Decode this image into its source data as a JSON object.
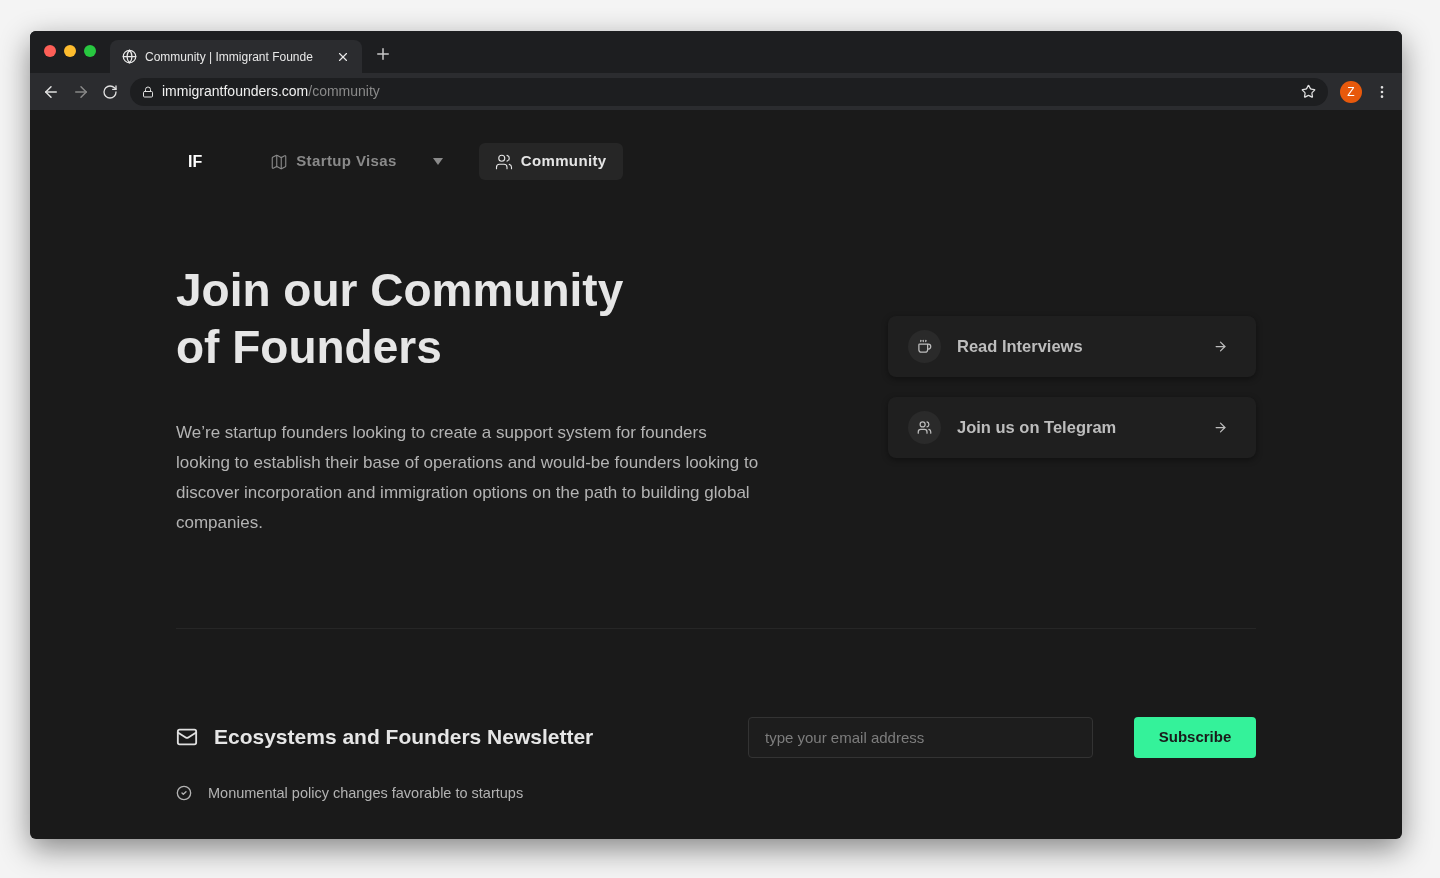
{
  "browser": {
    "tab_title": "Community | Immigrant Founde",
    "url_host": "immigrantfounders.com",
    "url_path": "/community",
    "profile_initial": "Z"
  },
  "nav": {
    "logo": "IF",
    "items": [
      {
        "label": "Startup Visas",
        "kind": "dropdown",
        "selected": false
      },
      {
        "label": "Community",
        "kind": "link",
        "selected": true
      }
    ]
  },
  "hero": {
    "title_lines": [
      "Join our Community",
      "of Founders"
    ],
    "text": "We’re startup founders looking to create a support system for founders looking to establish their base of operations and would-be founders looking to discover incorporation and immigration options on the path to building global companies."
  },
  "cards": [
    {
      "label": "Read Interviews",
      "kind": "cup"
    },
    {
      "label": "Join us on Telegram",
      "kind": "people"
    }
  ],
  "newsletter": {
    "title": "Ecosystems and Founders Newsletter",
    "points": [
      "Monumental policy changes favorable to startups"
    ],
    "email_placeholder": "type your email address",
    "button": "Subscribe"
  }
}
